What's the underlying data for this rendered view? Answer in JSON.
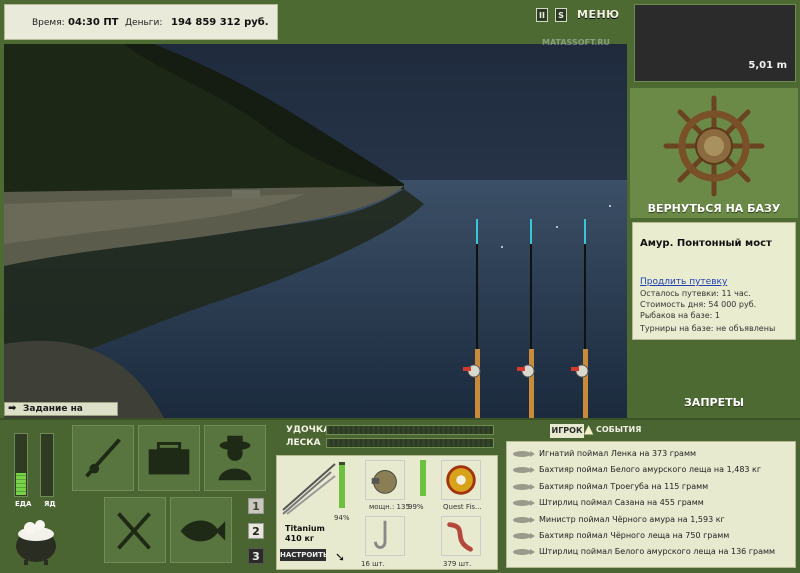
{
  "status": {
    "time_label": "Время:",
    "time_value": "04:30 ПТ",
    "money_label": "Деньги:",
    "money_value": "194 859 312 руб."
  },
  "header": {
    "pause_label": "II",
    "sound_label": "S",
    "menu_label": "МЕНЮ",
    "watermark": "MATASSOFT.RU"
  },
  "scene": {
    "task_label": "Задание на турнир",
    "rods_count": 3
  },
  "depth": {
    "value": "5,01 m"
  },
  "base": {
    "return_label": "ВЕРНУТЬСЯ НА БАЗУ",
    "location": "Амур. Понтонный мост",
    "extend_link": "Продлить путевку",
    "lines": [
      "Осталось путевки: 11 час.",
      "Стоимость дня: 54 000 руб.",
      "Рыбаков на базе: 1",
      "Турниры на базе: не объявлены"
    ],
    "bans_label": "ЗАПРЕТЫ"
  },
  "needs": {
    "food_label": "ЕДА",
    "poison_label": "ЯД",
    "food_level": 0.35,
    "poison_level": 0.0
  },
  "pages": [
    "1",
    "2",
    "3"
  ],
  "tackle": {
    "rod_label": "УДОЧКА",
    "line_label": "ЛЕСКА",
    "rod_name": "Titanium",
    "rod_weight": "410 кг",
    "rod_percent": "94%",
    "rod_level": 0.94,
    "reel_label": "мощн.: 135",
    "reel_percent": "99%",
    "reel_level": 0.99,
    "line_name": "Quest Fis...",
    "hook_count": "16 шт.",
    "bait_count": "379 шт.",
    "setup_label": "НАСТРОИТЬ"
  },
  "events": {
    "tab_player": "ИГРОК",
    "tab_events": "СОБЫТИЯ",
    "items": [
      "Игнатий поймал Ленка на 373 грамм",
      "Бахтияр поймал Белого амурского леща на 1,483 кг",
      "Бахтияр поймал Троегуба на 115 грамм",
      "Штирлиц поймал Сазана на 455 грамм",
      "Министр поймал Чёрного амура на 1,593 кг",
      "Бахтияр поймал Чёрного леща на 750 грамм",
      "Штирлиц поймал Белого амурского леща на 136 грамм"
    ]
  },
  "colors": {
    "panel_green": "#4d6a33",
    "light_panel": "#e8ead0",
    "link_blue": "#1f3fb6",
    "meter_green": "#7ad14a"
  }
}
